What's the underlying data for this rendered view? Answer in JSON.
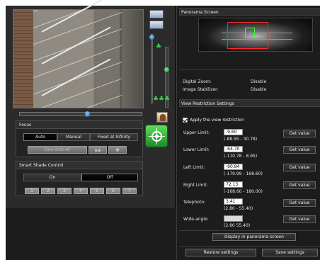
{
  "focus": {
    "title": "Focus",
    "modes": [
      "Auto",
      "Manual",
      "Fixed at Infinity"
    ],
    "selected": "Auto",
    "one_shot_af": "One-shot AF"
  },
  "smart_shade": {
    "title": "Smart Shade Control",
    "on": "On",
    "off": "Off",
    "levels": [
      "1",
      "2",
      "3",
      "4",
      "5",
      "6",
      "7"
    ]
  },
  "panorama": {
    "title": "Panorama Screen"
  },
  "status": {
    "digital_zoom_label": "Digital Zoom:",
    "digital_zoom_value": "Disable",
    "stabilizer_label": "Image Stabilizer:",
    "stabilizer_value": "Disable"
  },
  "restriction": {
    "title": "View Restriction Settings",
    "apply_label": "Apply the view restriction",
    "apply_checked": true,
    "get_value_label": "Get value",
    "limits": [
      {
        "label": "Upper Limit:",
        "value": "-9.60",
        "range": "(-88.95 - 30.78)"
      },
      {
        "label": "Lower Limit:",
        "value": "-64.70",
        "range": "(-110.78 - 8.95)"
      },
      {
        "label": "Left Limit:",
        "value": "-90.84",
        "range": "(-179.99 - 168.60)"
      },
      {
        "label": "Right Limit:",
        "value": "72.13",
        "range": "(-168.60 - 180.00)"
      },
      {
        "label": "Telephoto:",
        "value": "3.41",
        "range": "(2.80 - 55.40)"
      },
      {
        "label": "Wide-angle:",
        "value": "",
        "range": "(2.80   55.40)"
      }
    ],
    "display_button": "Display in panorama screen"
  },
  "footer": {
    "restore": "Restore settings",
    "save": "Save settings"
  }
}
